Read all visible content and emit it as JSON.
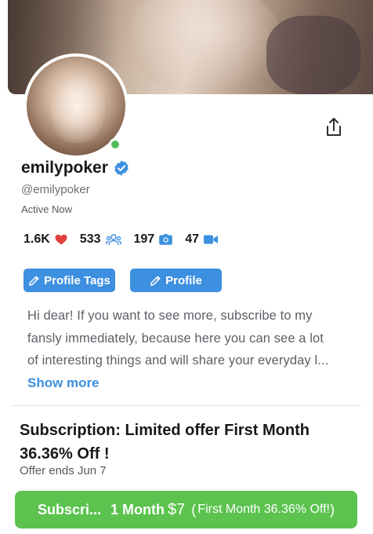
{
  "profile": {
    "name": "emilypoker",
    "handle": "@emilypoker",
    "status": "Active Now"
  },
  "stats": {
    "likes": "1.6K",
    "followers": "533",
    "photos": "197",
    "videos": "47"
  },
  "buttons": {
    "profile_tags": "Profile Tags",
    "profile": "Profile"
  },
  "bio": {
    "lines": [
      "Hi dear! If you want to see more, subscribe to my",
      "fansly immediately, because here you can see a lot",
      "of interesting things and will share your everyday l..."
    ],
    "show_more": "Show more"
  },
  "subscription": {
    "title": "Subscription: Limited offer First Month 36.36% Off !",
    "offer_ends": "Offer ends Jun 7",
    "button": {
      "label": "Subscri...",
      "duration": "1 Month",
      "price": "$7",
      "open_paren": "(",
      "discount": "First Month 36.36% Off!",
      "close_paren": ")"
    }
  },
  "icons": {
    "likes": "heart-icon",
    "followers": "users-icon",
    "photos": "camera-icon",
    "videos": "video-camera-icon",
    "share": "share-icon",
    "verified": "verified-badge-icon",
    "edit": "pencil-icon"
  },
  "colors": {
    "accent": "#3d8fe0",
    "subscribe": "#5cc34f",
    "online": "#4ebd5a",
    "heart": "#e0413f"
  }
}
